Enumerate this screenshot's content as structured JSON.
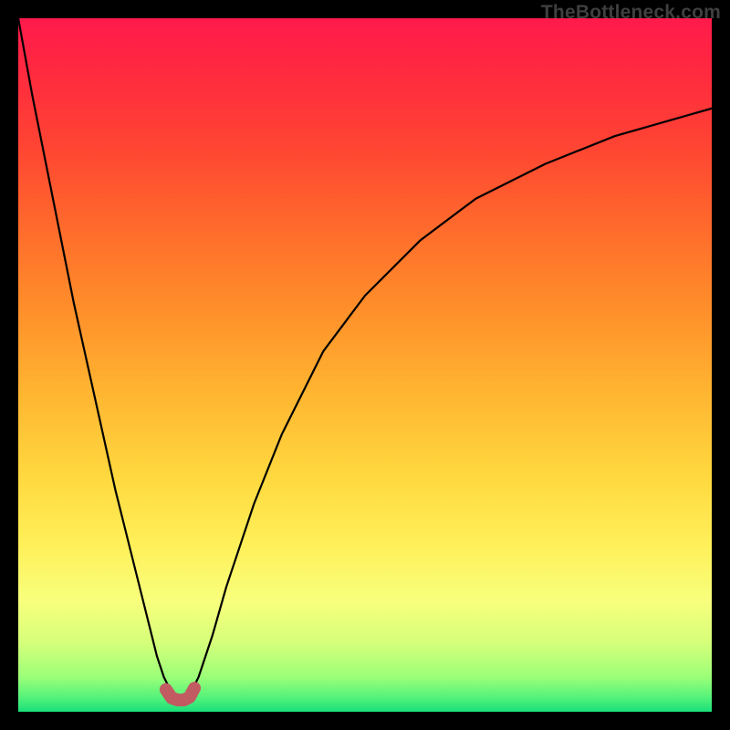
{
  "watermark": "TheBottleneck.com",
  "chart_data": {
    "type": "line",
    "title": "",
    "xlabel": "",
    "ylabel": "",
    "xlim": [
      0,
      100
    ],
    "ylim": [
      0,
      100
    ],
    "grid": false,
    "legend": false,
    "series": [
      {
        "name": "bottleneck-curve",
        "color": "#000000",
        "x": [
          0,
          2,
          4,
          6,
          8,
          10,
          12,
          14,
          16,
          18,
          20,
          21,
          22,
          23,
          24,
          25,
          26,
          28,
          30,
          34,
          38,
          44,
          50,
          58,
          66,
          76,
          86,
          100
        ],
        "y": [
          100,
          89,
          79,
          69,
          59,
          50,
          41,
          32,
          24,
          16,
          8,
          5,
          3,
          2,
          2,
          3,
          5,
          11,
          18,
          30,
          40,
          52,
          60,
          68,
          74,
          79,
          83,
          87
        ]
      },
      {
        "name": "salient-minimum-marker",
        "color": "#c25a62",
        "marker": "round",
        "x": [
          21.3,
          22.1,
          23.0,
          23.9,
          24.7,
          25.4
        ],
        "y": [
          3.2,
          2.0,
          1.7,
          1.7,
          2.1,
          3.4
        ]
      }
    ],
    "background_gradient": {
      "top": "#ff1a4b",
      "mid": "#ffd83e",
      "bottom": "#19e07a"
    }
  }
}
